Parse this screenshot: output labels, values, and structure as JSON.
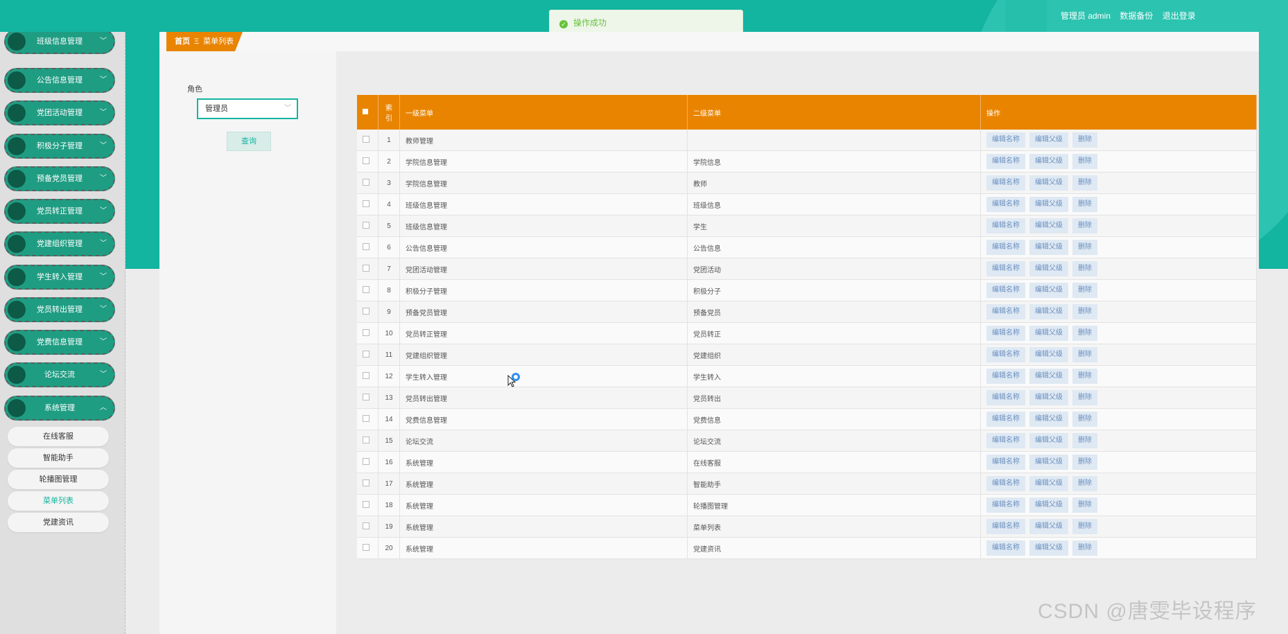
{
  "header": {
    "user_info": "管理员 admin",
    "backup_link": "数据备份",
    "logout_link": "退出登录",
    "toast_message": "操作成功"
  },
  "sidebar": {
    "menu_items": [
      {
        "label": "班级信息管理",
        "chevron": "chevron-down-icon"
      },
      {
        "label": "公告信息管理",
        "chevron": "chevron-down-icon"
      },
      {
        "label": "党团活动管理",
        "chevron": "chevron-down-icon"
      },
      {
        "label": "积极分子管理",
        "chevron": "chevron-down-icon"
      },
      {
        "label": "预备党员管理",
        "chevron": "chevron-down-icon"
      },
      {
        "label": "党员转正管理",
        "chevron": "chevron-down-icon"
      },
      {
        "label": "党建组织管理",
        "chevron": "chevron-down-icon"
      },
      {
        "label": "学生转入管理",
        "chevron": "chevron-down-icon"
      },
      {
        "label": "党员转出管理",
        "chevron": "chevron-down-icon"
      },
      {
        "label": "党费信息管理",
        "chevron": "chevron-down-icon"
      },
      {
        "label": "论坛交流",
        "chevron": "chevron-down-icon"
      },
      {
        "label": "系统管理",
        "chevron": "chevron-up-icon"
      }
    ],
    "sub_items": [
      {
        "label": "在线客服",
        "active": false
      },
      {
        "label": "智能助手",
        "active": false
      },
      {
        "label": "轮播图管理",
        "active": false
      },
      {
        "label": "菜单列表",
        "active": true
      },
      {
        "label": "党建资讯",
        "active": false
      }
    ]
  },
  "breadcrumb": {
    "home": "首页",
    "separator": "Ξ",
    "current": "菜单列表"
  },
  "filter": {
    "role_label": "角色",
    "role_value": "管理员",
    "query_button": "查询"
  },
  "table": {
    "headers": {
      "index": "索引",
      "level1": "一级菜单",
      "level2": "二级菜单",
      "actions": "操作"
    },
    "action_labels": {
      "edit_name": "编辑名称",
      "edit_parent": "编辑父级",
      "delete": "删除"
    },
    "rows": [
      {
        "index": "1",
        "level1": "教师管理",
        "level2": ""
      },
      {
        "index": "2",
        "level1": "学院信息管理",
        "level2": "学院信息"
      },
      {
        "index": "3",
        "level1": "学院信息管理",
        "level2": "教师"
      },
      {
        "index": "4",
        "level1": "班级信息管理",
        "level2": "班级信息"
      },
      {
        "index": "5",
        "level1": "班级信息管理",
        "level2": "学生"
      },
      {
        "index": "6",
        "level1": "公告信息管理",
        "level2": "公告信息"
      },
      {
        "index": "7",
        "level1": "党团活动管理",
        "level2": "党团活动"
      },
      {
        "index": "8",
        "level1": "积极分子管理",
        "level2": "积极分子"
      },
      {
        "index": "9",
        "level1": "预备党员管理",
        "level2": "预备党员"
      },
      {
        "index": "10",
        "level1": "党员转正管理",
        "level2": "党员转正"
      },
      {
        "index": "11",
        "level1": "党建组织管理",
        "level2": "党建组织"
      },
      {
        "index": "12",
        "level1": "学生转入管理",
        "level2": "学生转入"
      },
      {
        "index": "13",
        "level1": "党员转出管理",
        "level2": "党员转出"
      },
      {
        "index": "14",
        "level1": "党费信息管理",
        "level2": "党费信息"
      },
      {
        "index": "15",
        "level1": "论坛交流",
        "level2": "论坛交流"
      },
      {
        "index": "16",
        "level1": "系统管理",
        "level2": "在线客服"
      },
      {
        "index": "17",
        "level1": "系统管理",
        "level2": "智能助手"
      },
      {
        "index": "18",
        "level1": "系统管理",
        "level2": "轮播图管理"
      },
      {
        "index": "19",
        "level1": "系统管理",
        "level2": "菜单列表"
      },
      {
        "index": "20",
        "level1": "系统管理",
        "level2": "党建资讯"
      }
    ]
  },
  "watermark": "CSDN @唐雯毕设程序",
  "colors": {
    "primary": "#13b4a0",
    "header_orange": "#e98400",
    "sidebar_green": "#1f9d83",
    "action_blue": "#6a8fc0"
  }
}
